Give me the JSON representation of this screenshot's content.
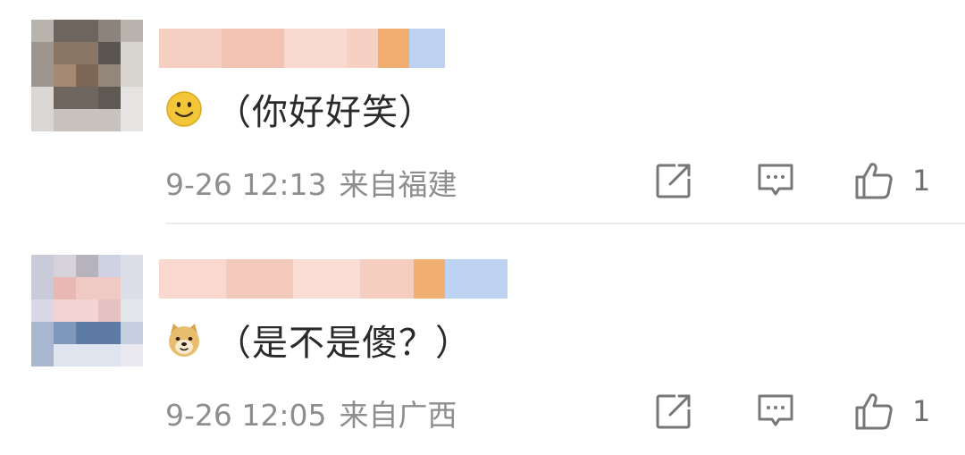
{
  "comments": [
    {
      "text": "（你好好笑）",
      "emoji": "smile-emoji",
      "time": "9-26 12:13",
      "location": "来自福建",
      "like_count": "1"
    },
    {
      "text": "（是不是傻？）",
      "emoji": "doge-emoji",
      "time": "9-26 12:05",
      "location": "来自广西",
      "like_count": "1"
    }
  ],
  "icons": {
    "share": "share-icon",
    "reply": "comment-icon",
    "like": "thumbs-up-icon"
  },
  "colors": {
    "meta_text": "#8e8e8e",
    "icon_stroke": "#777777",
    "divider": "#ececec",
    "emoji_yellow": "#f3c63a"
  }
}
